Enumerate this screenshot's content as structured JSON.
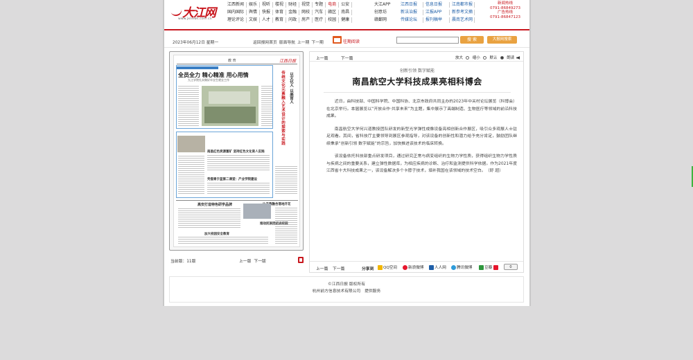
{
  "header": {
    "logo_text": "大江网",
    "logo_url": "www.jxnews.com.cn",
    "nav_rows": [
      [
        "江西新闻",
        "娱乐",
        "视听",
        "楼视",
        "财经",
        "视觉",
        "专题",
        "电商",
        "公安"
      ],
      [
        "国内国际",
        "舆情",
        "快报",
        "体育",
        "金融",
        "网校",
        "汽车",
        "赣区",
        "南昌"
      ],
      [
        "理论评论",
        "文娱",
        "人才",
        "教育",
        "问政",
        "房产",
        "医疗",
        "校园",
        "健康"
      ]
    ],
    "nav_extra": [
      "大江APP",
      "创意坊",
      "赣鄱网"
    ],
    "nav_highlight": "电商",
    "nav2_rows": [
      [
        "江西日报",
        "信息日报",
        "江南都市报"
      ],
      [
        "新法治报",
        "江报APP",
        "新参考文摘"
      ],
      [
        "传媒论坛",
        "报刊稿举",
        "晨南艺术网"
      ]
    ],
    "hotline": [
      "新闻热线",
      "0791-86849273",
      "广告热线",
      "0791-86847123"
    ]
  },
  "toolbar": {
    "date": "2023年06月12日 星期一",
    "crumbs": [
      "返回报网首页",
      "版面导航",
      "上一期",
      "下一期"
    ],
    "past_issue": "往期阅读",
    "search_placeholder": "",
    "search_label": "搜 索",
    "site_search_label": "大报网搜索"
  },
  "paper": {
    "section": "教 育",
    "masthead": "江西日报",
    "headline": "全员全力 精心精准 用心用情",
    "subhead": "九江学院扎实做好毕业生就业工作",
    "vertical_title_1": "传统文化元素融入艺术设计的探索与实践",
    "vertical_title_2": "以文化人 以美育人",
    "box_title_1": "南昌红色资源富矿 坚持红色文化育人实践",
    "box_title_2": "凭借青于蓝第二课堂：产业学院建设",
    "bottom_title_1": "高安打造特色研学品牌",
    "bottom_title_2": "让产教融合落地开花",
    "bottom_title_3": "加大校园安全教育",
    "bottom_title_4": "推动民族团结进校园",
    "current_page_label": "当前版：",
    "current_page": "11版",
    "prev_page": "上一版",
    "next_page": "下一版"
  },
  "article": {
    "prev": "上一篇",
    "next": "下一篇",
    "font_label_big": "放大",
    "font_label_small": "缩小",
    "font_label_default": "默认",
    "font_label_read": "朗读",
    "kicker": "创新引领 数字赋能",
    "title": "南昌航空大学科技成果亮相科博会",
    "paragraphs": [
      "近日，由科技部、中国科学院、中国科协、北京市政府共同主办的2023年中关村论坛展览（科博会）在北京举行。本届展览以“开放合作·共享未来”为主题，集中展示了高端制造、生物医疗等领域的前沿科技成果。",
      "南昌航空大学何兴道教授团队研发的新型光学弹性成像设备亮相创新合作展区，吸引众多观展人士驻足观看。其间，省科技厅主要领导到展区参观指导，对该设备的创新性和潜力给予充分肯定，鼓励团队继续秉承“创新引领 数字赋能”的宗旨，加快推进该技术的临床转换。",
      "该设备依托科技部重点研发项目，通过研究正常与病变组织的生物力学性质，获得组织生物力学性质与疾病之间的重要关系，建立弹性数据库，为相应疾病的诊断、治疗和监测提供科学依据。作为2021年度江西省十大科技成果之一，该设备解决多个卡脖子技术，填补我国在该领域的技术空白。（舒 超）"
    ],
    "share_label": "分享到",
    "share_items": [
      "QQ空间",
      "新浪微博",
      "人人网",
      "腾讯微博",
      "豆瓣"
    ],
    "plus_label": "0"
  },
  "footer": {
    "line1": "©江西日报 版权所有",
    "line2": "杭州前方信息技术有限公司　提供服务"
  },
  "colors": {
    "brand_red": "#c8161d",
    "link_blue": "#1f5fa8",
    "search_orange": "#e9a241"
  }
}
